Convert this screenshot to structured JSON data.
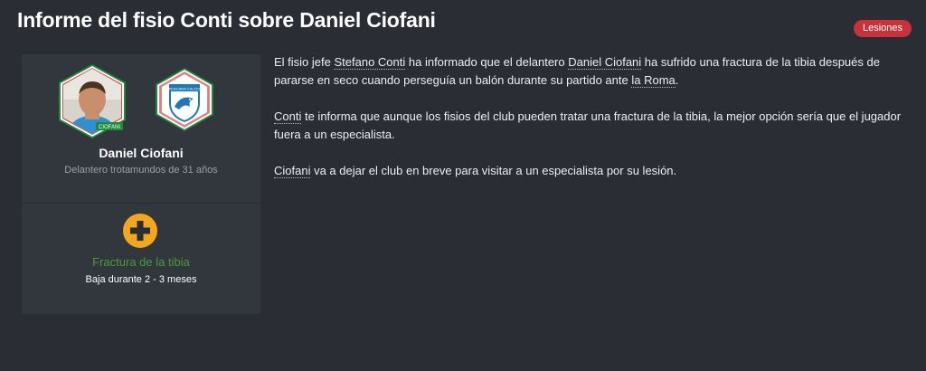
{
  "header": {
    "title": "Informe del fisio Conti sobre Daniel Ciofani",
    "badge": "Lesiones"
  },
  "player": {
    "name": "Daniel Ciofani",
    "description": "Delantero trotamundos de 31 años",
    "photo_caption": "CIOFANI",
    "club_crest_text": "PESCARA CALCIO"
  },
  "injury": {
    "name": "Fractura de la tibia",
    "duration": "Baja durante 2 - 3 meses"
  },
  "report": {
    "p1": {
      "a": "El fisio jefe ",
      "link1": "Stefano Conti",
      "b": " ha informado que el delantero ",
      "link2": "Daniel Ciofani",
      "c": " ha sufrido una fractura de la tibia después de pararse en seco cuando perseguía un balón durante su partido ante ",
      "link3": "la Roma",
      "d": "."
    },
    "p2": {
      "link1": "Conti",
      "a": " te informa que aunque los fisios del club pueden tratar una fractura de la tibia, la mejor opción sería que el jugador fuera a un especialista."
    },
    "p3": {
      "link1": "Ciofani",
      "a": " va a dejar el club en breve para visitar a un especialista por su lesión."
    }
  },
  "colors": {
    "background": "#2a2d33",
    "card": "#32363d",
    "badge": "#c8323a",
    "injury_text": "#4a9a3c",
    "plus_icon": "#f2a81e"
  }
}
